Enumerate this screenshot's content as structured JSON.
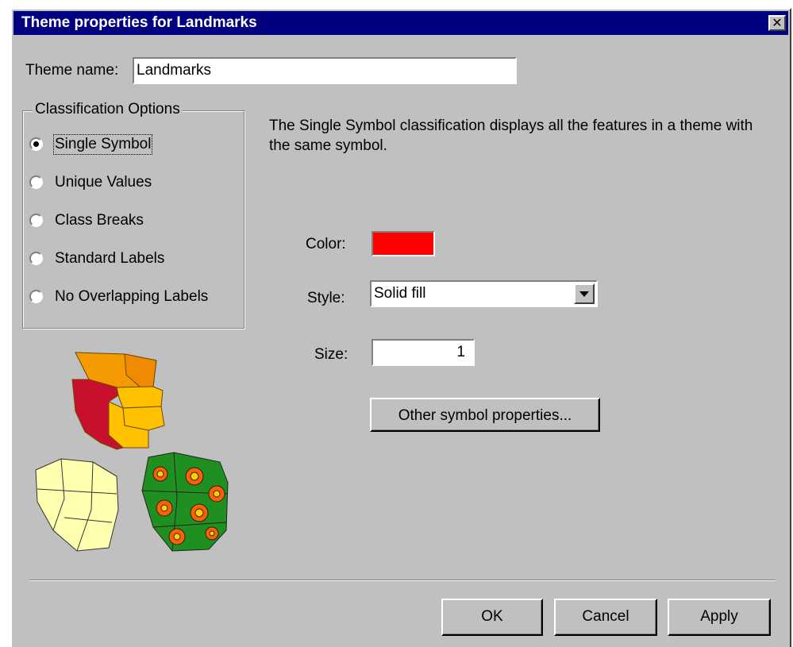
{
  "window": {
    "title": "Theme properties for Landmarks",
    "close_icon": "close-icon"
  },
  "theme_name": {
    "label": "Theme name:",
    "value": "Landmarks"
  },
  "classification": {
    "group_label": "Classification Options",
    "options": [
      {
        "label": "Single Symbol",
        "checked": true
      },
      {
        "label": "Unique Values",
        "checked": false
      },
      {
        "label": "Class Breaks",
        "checked": false
      },
      {
        "label": "Standard Labels",
        "checked": false
      },
      {
        "label": "No Overlapping Labels",
        "checked": false
      }
    ]
  },
  "description": "The Single Symbol classification displays all the features in a theme with the same symbol.",
  "symbol": {
    "color_label": "Color:",
    "color_value": "#ff0000",
    "style_label": "Style:",
    "style_value": "Solid fill",
    "size_label": "Size:",
    "size_value": "1",
    "other_button": "Other symbol properties..."
  },
  "buttons": {
    "ok": "OK",
    "cancel": "Cancel",
    "apply": "Apply"
  }
}
